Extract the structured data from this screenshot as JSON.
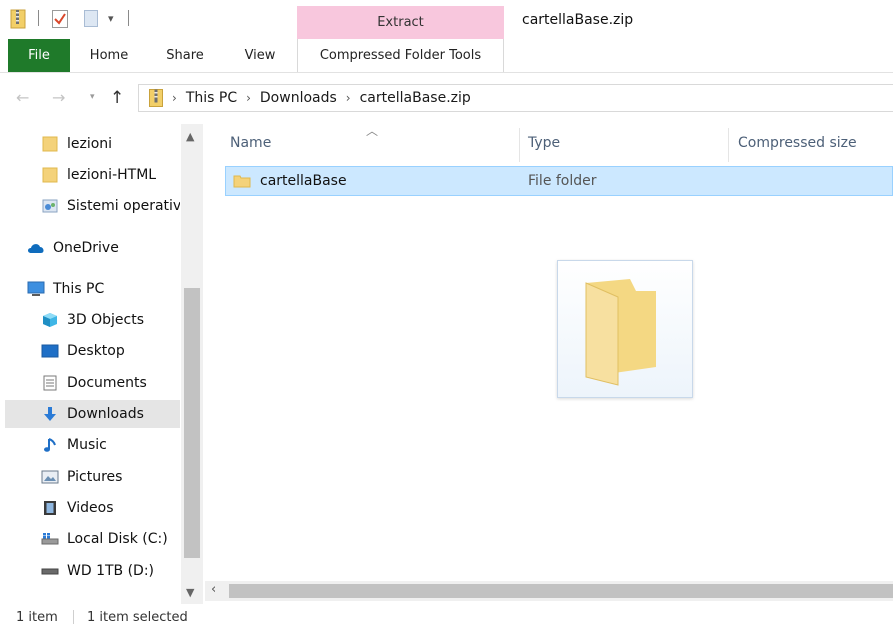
{
  "window": {
    "title": "cartellaBase.zip"
  },
  "contextual_tab": {
    "label": "Extract",
    "color": "#f8c7dd"
  },
  "ribbon": {
    "tabs": [
      {
        "label": "File",
        "active": false,
        "color": "#1f7a2a"
      },
      {
        "label": "Home"
      },
      {
        "label": "Share"
      },
      {
        "label": "View"
      },
      {
        "label": "Compressed Folder Tools",
        "active": true
      }
    ]
  },
  "address": {
    "icon": "zip-folder-icon",
    "crumbs": [
      "This PC",
      "Downloads",
      "cartellaBase.zip"
    ],
    "separator": "›"
  },
  "nav": {
    "items": [
      {
        "label": "lezioni",
        "icon": "folder-icon"
      },
      {
        "label": "lezioni-HTML",
        "icon": "folder-icon"
      },
      {
        "label": "Sistemi operativi",
        "icon": "shared-folder-icon"
      },
      {
        "label": "OneDrive",
        "icon": "onedrive-cloud-icon"
      },
      {
        "label": "This PC",
        "icon": "this-pc-icon"
      },
      {
        "label": "3D Objects",
        "icon": "3d-objects-icon"
      },
      {
        "label": "Desktop",
        "icon": "desktop-icon"
      },
      {
        "label": "Documents",
        "icon": "documents-icon"
      },
      {
        "label": "Downloads",
        "icon": "downloads-icon",
        "selected": true
      },
      {
        "label": "Music",
        "icon": "music-icon"
      },
      {
        "label": "Pictures",
        "icon": "pictures-icon"
      },
      {
        "label": "Videos",
        "icon": "videos-icon"
      },
      {
        "label": "Local Disk (C:)",
        "icon": "local-disk-icon"
      },
      {
        "label": "WD 1TB (D:)",
        "icon": "drive-icon"
      }
    ]
  },
  "columns": {
    "name": "Name",
    "type": "Type",
    "compressed_size": "Compressed size"
  },
  "files": [
    {
      "name": "cartellaBase",
      "type": "File folder",
      "icon": "folder-icon",
      "selected": true
    }
  ],
  "status": {
    "count": "1 item",
    "selected": "1 item selected"
  },
  "colors": {
    "selection": "#cce8ff",
    "selection_border": "#99d1ff",
    "folder": "#f4d27a"
  }
}
